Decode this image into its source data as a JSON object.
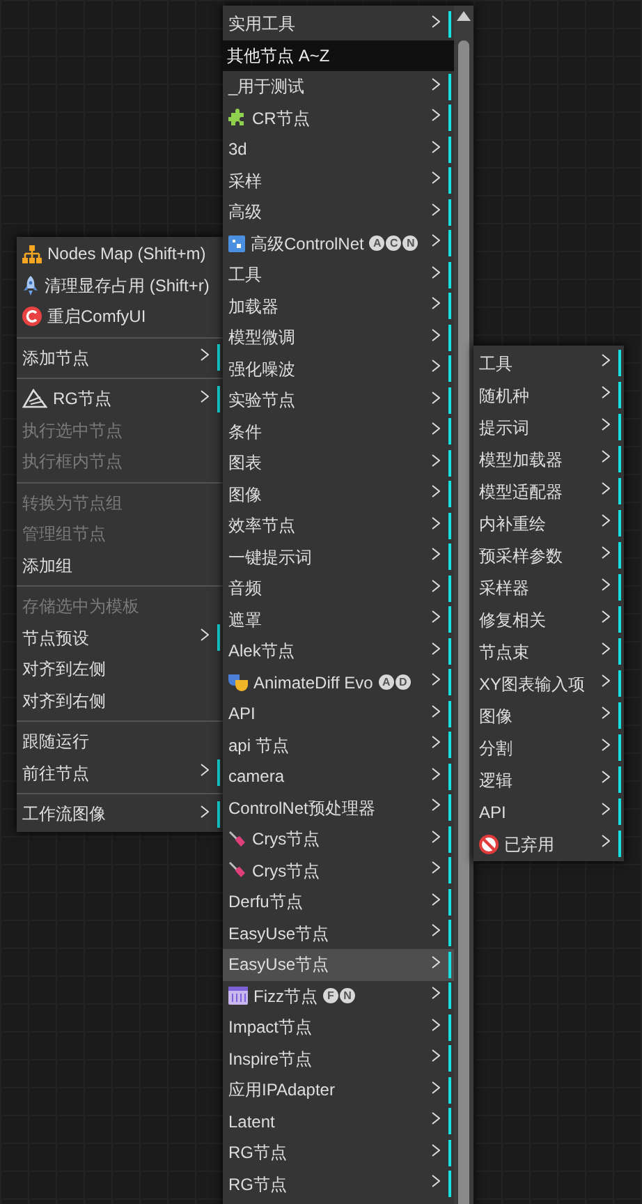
{
  "canvas_menu": {
    "items": [
      {
        "label": "Nodes Map (Shift+m)",
        "kind": "action",
        "disabled": false
      },
      {
        "label": "清理显存占用 (Shift+r)",
        "kind": "action",
        "disabled": false
      },
      {
        "label": "重启ComfyUI",
        "kind": "action",
        "disabled": false
      },
      {
        "kind": "separator"
      },
      {
        "label": "添加节点",
        "kind": "submenu",
        "disabled": false
      },
      {
        "kind": "separator"
      },
      {
        "label": "RG节点",
        "kind": "submenu",
        "disabled": false
      },
      {
        "label": "执行选中节点",
        "kind": "action",
        "disabled": true
      },
      {
        "label": "执行框内节点",
        "kind": "action",
        "disabled": true
      },
      {
        "kind": "separator"
      },
      {
        "label": "转换为节点组",
        "kind": "action",
        "disabled": true
      },
      {
        "label": "管理组节点",
        "kind": "action",
        "disabled": true
      },
      {
        "label": "添加组",
        "kind": "action",
        "disabled": false
      },
      {
        "kind": "separator"
      },
      {
        "label": "存储选中为模板",
        "kind": "action",
        "disabled": true
      },
      {
        "label": "节点预设",
        "kind": "submenu",
        "disabled": false
      },
      {
        "label": "对齐到左侧",
        "kind": "action",
        "disabled": false
      },
      {
        "label": "对齐到右侧",
        "kind": "action",
        "disabled": false
      },
      {
        "kind": "separator"
      },
      {
        "label": "跟随运行",
        "kind": "action",
        "disabled": false
      },
      {
        "label": "前往节点",
        "kind": "submenu",
        "disabled": false
      },
      {
        "kind": "separator"
      },
      {
        "label": "工作流图像",
        "kind": "submenu",
        "disabled": false
      }
    ]
  },
  "add_node_menu": {
    "items": [
      {
        "label": "实用工具",
        "kind": "submenu",
        "selected": false
      },
      {
        "label": "其他节点 A~Z",
        "kind": "header"
      },
      {
        "label": "_用于测试",
        "kind": "submenu",
        "selected": false
      },
      {
        "label": "CR节点",
        "kind": "submenu",
        "selected": false
      },
      {
        "label": "3d",
        "kind": "submenu",
        "selected": false
      },
      {
        "label": "采样",
        "kind": "submenu",
        "selected": false
      },
      {
        "label": "高级",
        "kind": "submenu",
        "selected": false
      },
      {
        "label": "高级ControlNet",
        "kind": "submenu",
        "selected": false,
        "badges": [
          "A",
          "C",
          "N"
        ]
      },
      {
        "label": "工具",
        "kind": "submenu",
        "selected": false
      },
      {
        "label": "加载器",
        "kind": "submenu",
        "selected": false
      },
      {
        "label": "模型微调",
        "kind": "submenu",
        "selected": false
      },
      {
        "label": "强化噪波",
        "kind": "submenu",
        "selected": false
      },
      {
        "label": "实验节点",
        "kind": "submenu",
        "selected": false
      },
      {
        "label": "条件",
        "kind": "submenu",
        "selected": false
      },
      {
        "label": "图表",
        "kind": "submenu",
        "selected": false
      },
      {
        "label": "图像",
        "kind": "submenu",
        "selected": false
      },
      {
        "label": "效率节点",
        "kind": "submenu",
        "selected": false
      },
      {
        "label": "一键提示词",
        "kind": "submenu",
        "selected": false
      },
      {
        "label": "音频",
        "kind": "submenu",
        "selected": false
      },
      {
        "label": "遮罩",
        "kind": "submenu",
        "selected": false
      },
      {
        "label": "Alek节点",
        "kind": "submenu",
        "selected": false
      },
      {
        "label": "AnimateDiff Evo",
        "kind": "submenu",
        "selected": false,
        "badges": [
          "A",
          "D"
        ]
      },
      {
        "label": "API",
        "kind": "submenu",
        "selected": false
      },
      {
        "label": "api 节点",
        "kind": "submenu",
        "selected": false
      },
      {
        "label": "camera",
        "kind": "submenu",
        "selected": false
      },
      {
        "label": "ControlNet预处理器",
        "kind": "submenu",
        "selected": false
      },
      {
        "label": "Crys节点",
        "kind": "submenu",
        "selected": false
      },
      {
        "label": "Crys节点",
        "kind": "submenu",
        "selected": false
      },
      {
        "label": "Derfu节点",
        "kind": "submenu",
        "selected": false
      },
      {
        "label": "EasyUse节点",
        "kind": "submenu",
        "selected": false
      },
      {
        "label": "EasyUse节点",
        "kind": "submenu",
        "selected": true
      },
      {
        "label": "Fizz节点",
        "kind": "submenu",
        "selected": false,
        "badges": [
          "F",
          "N"
        ]
      },
      {
        "label": "Impact节点",
        "kind": "submenu",
        "selected": false
      },
      {
        "label": "Inspire节点",
        "kind": "submenu",
        "selected": false
      },
      {
        "label": "应用IPAdapter",
        "kind": "submenu",
        "selected": false
      },
      {
        "label": "Latent",
        "kind": "submenu",
        "selected": false
      },
      {
        "label": "RG节点",
        "kind": "submenu",
        "selected": false
      },
      {
        "label": "RG节点",
        "kind": "submenu",
        "selected": false
      }
    ]
  },
  "easyuse_menu": {
    "items": [
      {
        "label": "工具",
        "kind": "submenu"
      },
      {
        "label": "随机种",
        "kind": "submenu"
      },
      {
        "label": "提示词",
        "kind": "submenu"
      },
      {
        "label": "模型加载器",
        "kind": "submenu"
      },
      {
        "label": "模型适配器",
        "kind": "submenu"
      },
      {
        "label": "内补重绘",
        "kind": "submenu"
      },
      {
        "label": "预采样参数",
        "kind": "submenu"
      },
      {
        "label": "采样器",
        "kind": "submenu"
      },
      {
        "label": "修复相关",
        "kind": "submenu"
      },
      {
        "label": "节点束",
        "kind": "submenu"
      },
      {
        "label": "XY图表输入项",
        "kind": "submenu"
      },
      {
        "label": "图像",
        "kind": "submenu"
      },
      {
        "label": "分割",
        "kind": "submenu"
      },
      {
        "label": "逻辑",
        "kind": "submenu"
      },
      {
        "label": "API",
        "kind": "submenu"
      },
      {
        "label": "已弃用",
        "kind": "submenu"
      }
    ]
  }
}
